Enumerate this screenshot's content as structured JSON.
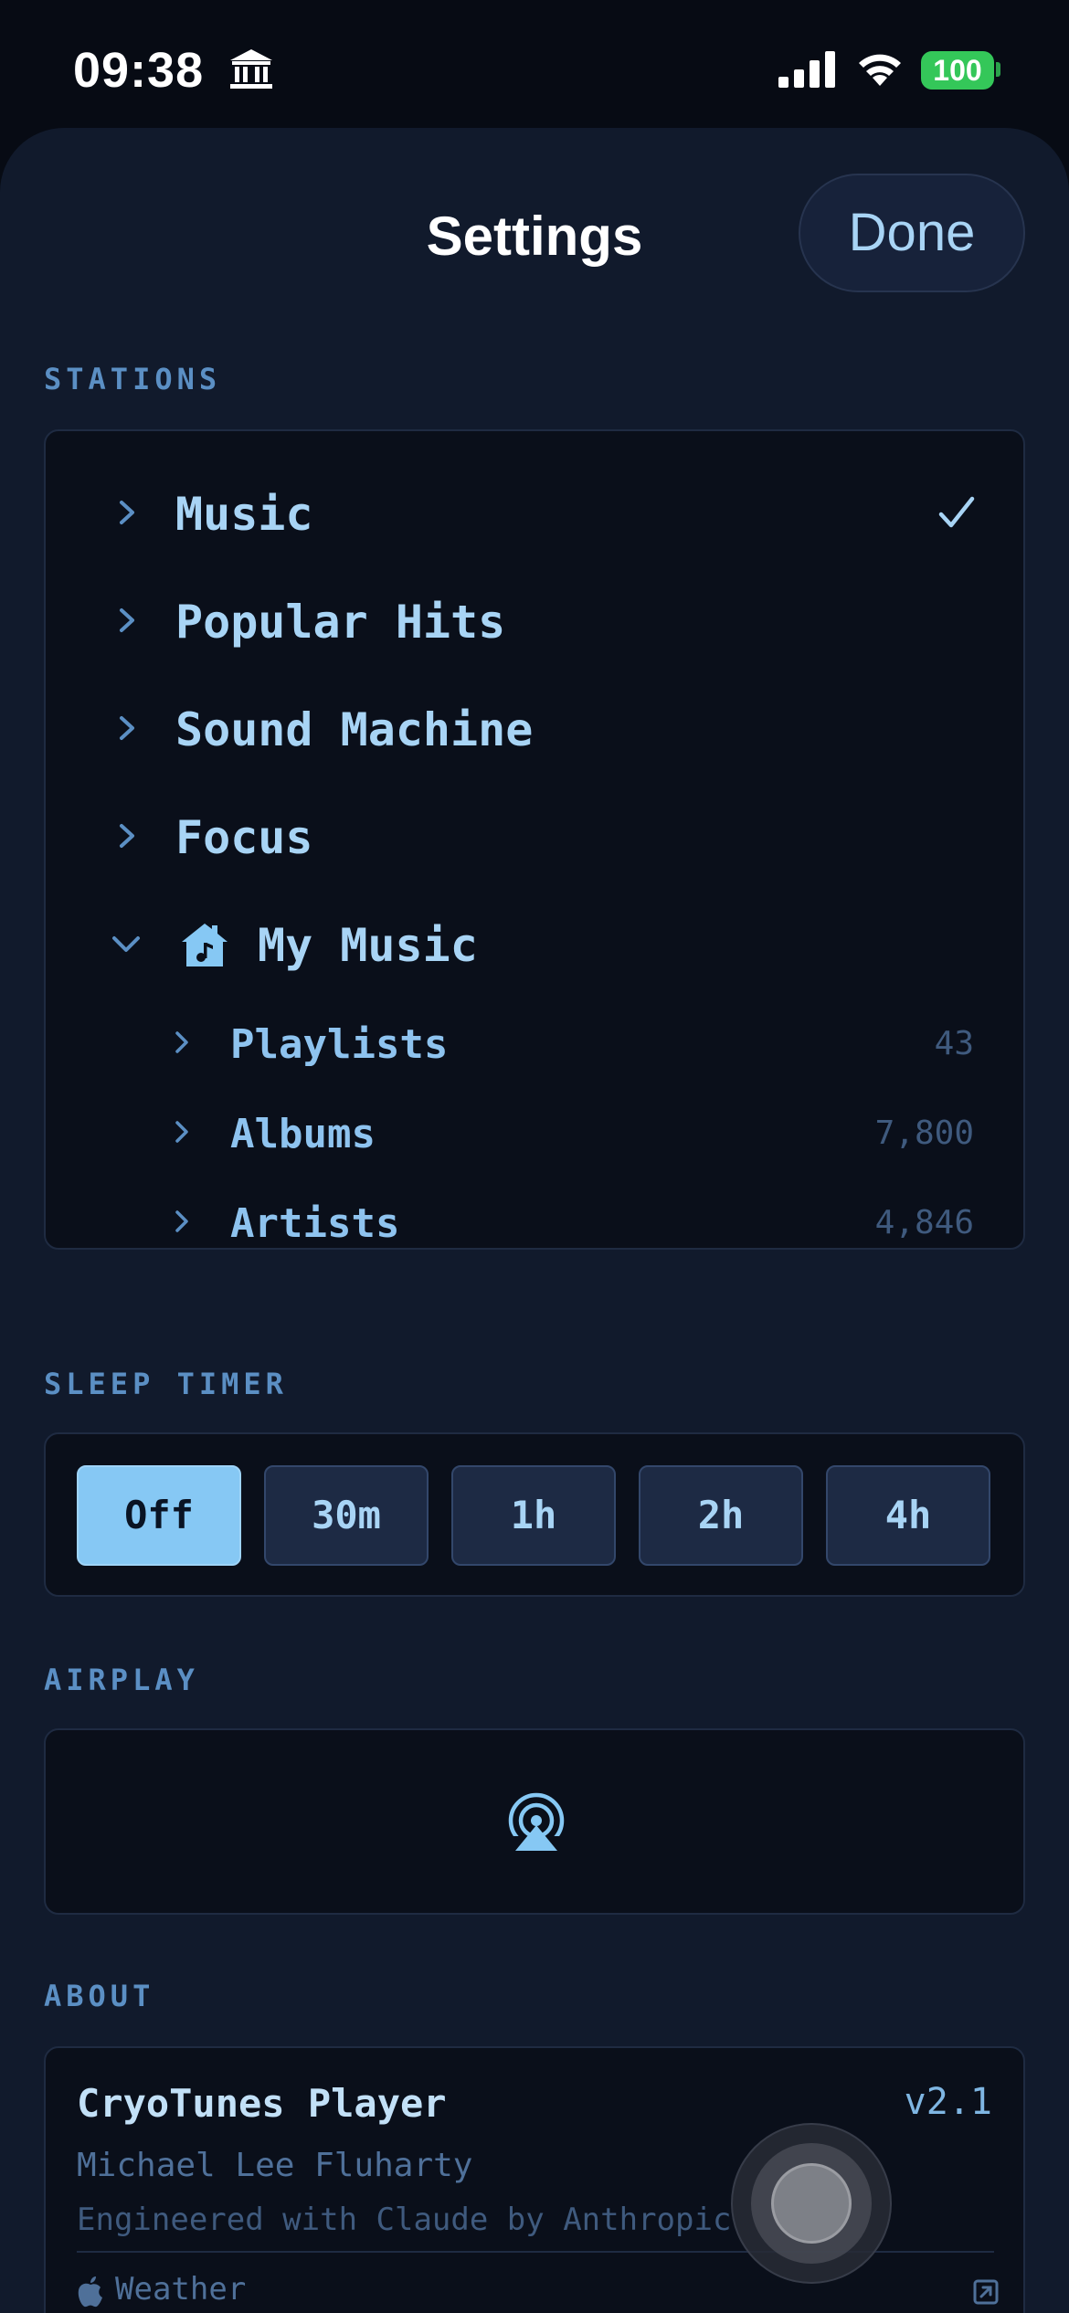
{
  "status_bar": {
    "time": "09:38",
    "battery": "100"
  },
  "header": {
    "title": "Settings",
    "done_label": "Done"
  },
  "stations": {
    "section_label": "STATIONS",
    "items": [
      {
        "label": "Music",
        "selected": true
      },
      {
        "label": "Popular Hits",
        "selected": false
      },
      {
        "label": "Sound Machine",
        "selected": false
      },
      {
        "label": "Focus",
        "selected": false
      },
      {
        "label": "My Music",
        "expanded": true,
        "icon": "home-music-icon"
      }
    ],
    "my_music": [
      {
        "label": "Playlists",
        "count": "43"
      },
      {
        "label": "Albums",
        "count": "7,800"
      },
      {
        "label": "Artists",
        "count": "4,846"
      }
    ]
  },
  "sleep_timer": {
    "section_label": "SLEEP TIMER",
    "options": [
      "Off",
      "30m",
      "1h",
      "2h",
      "4h"
    ],
    "selected": "Off"
  },
  "airplay": {
    "section_label": "AIRPLAY",
    "icon": "airplay-icon"
  },
  "about": {
    "section_label": "ABOUT",
    "app_name": "CryoTunes Player",
    "version": "v2.1",
    "author": "Michael Lee Fluharty",
    "credit": "Engineered with Claude by Anthropic",
    "weather_label": "Weather"
  },
  "colors": {
    "background": "#111a2c",
    "accent": "#86c8f4",
    "text": "#a8d4f5",
    "battery": "#34c759"
  }
}
